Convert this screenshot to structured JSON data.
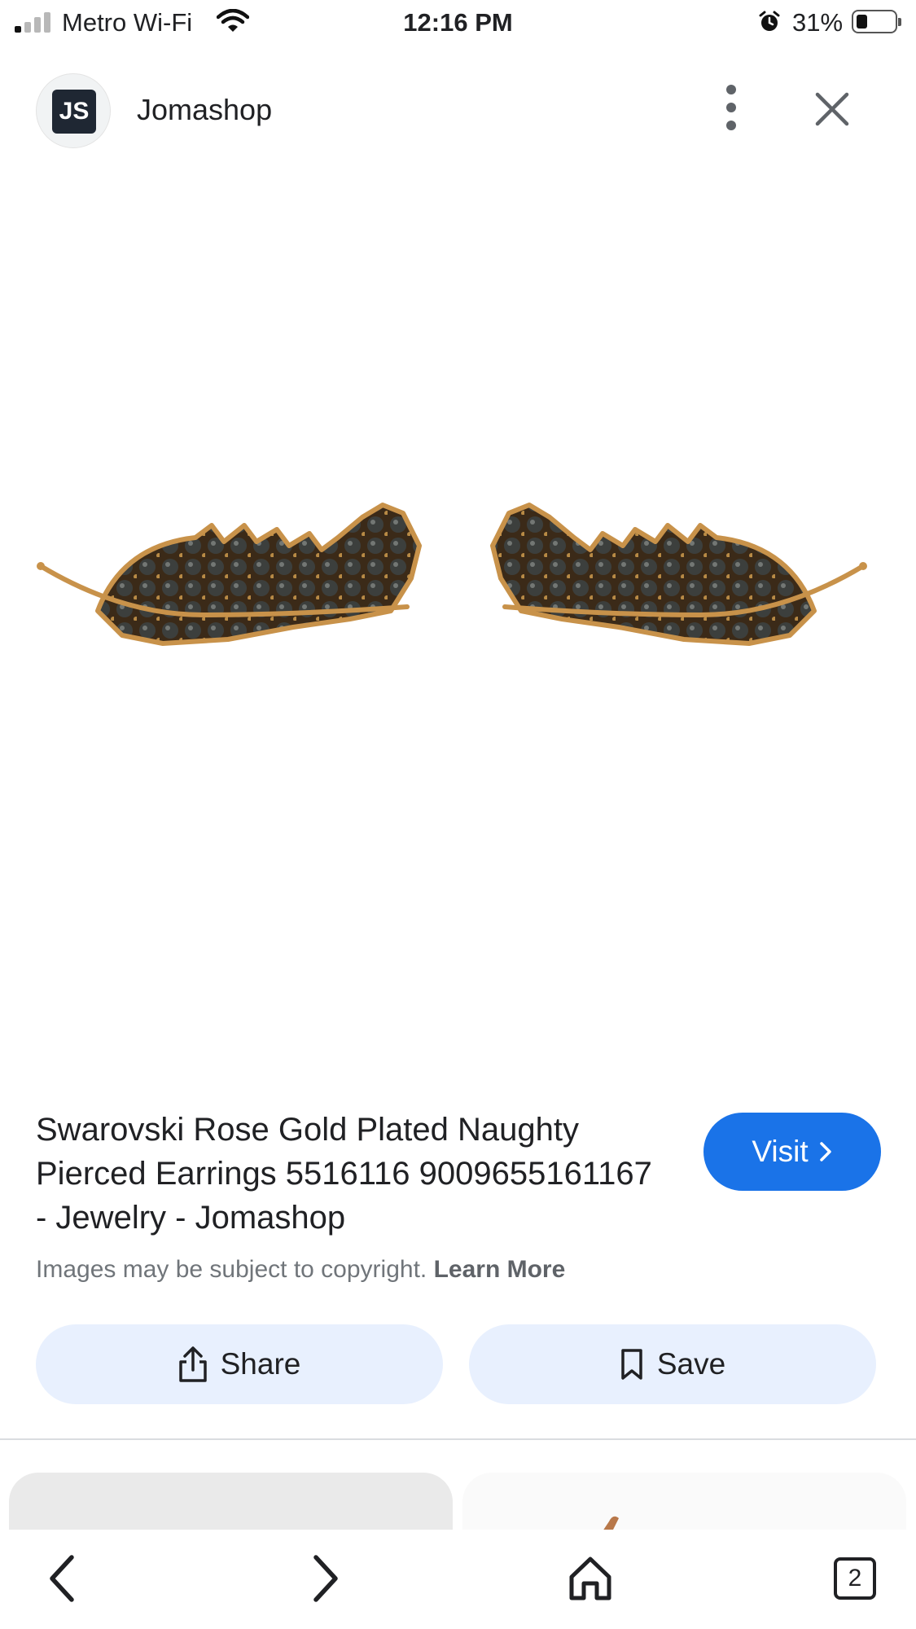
{
  "status_bar": {
    "carrier": "Metro Wi-Fi",
    "time": "12:16 PM",
    "battery_percent": "31%",
    "battery_level": 0.31,
    "signal_bars_active": 1,
    "icons": [
      "signal-icon",
      "wifi-icon",
      "alarm-icon",
      "battery-icon"
    ]
  },
  "header": {
    "site_logo_text": "JS",
    "site_name": "Jomashop",
    "icons": [
      "more-vert-icon",
      "close-icon"
    ]
  },
  "result": {
    "title": "Swarovski Rose Gold Plated Naughty Pierced Earrings 5516116 9009655161167 - Jewelry - Jomashop",
    "visit_label": "Visit",
    "copyright_text": "Images may be subject to copyright.",
    "learn_more": "Learn More",
    "share_label": "Share",
    "save_label": "Save"
  },
  "bottom_nav": {
    "tab_count": "2",
    "icons": [
      "back-icon",
      "forward-icon",
      "home-icon",
      "tabs-icon"
    ]
  },
  "colors": {
    "accent": "#1a73e8",
    "action_bg": "#e8f0fe",
    "earring_gold": "#c8924a",
    "stone": "#3c3f3d"
  }
}
